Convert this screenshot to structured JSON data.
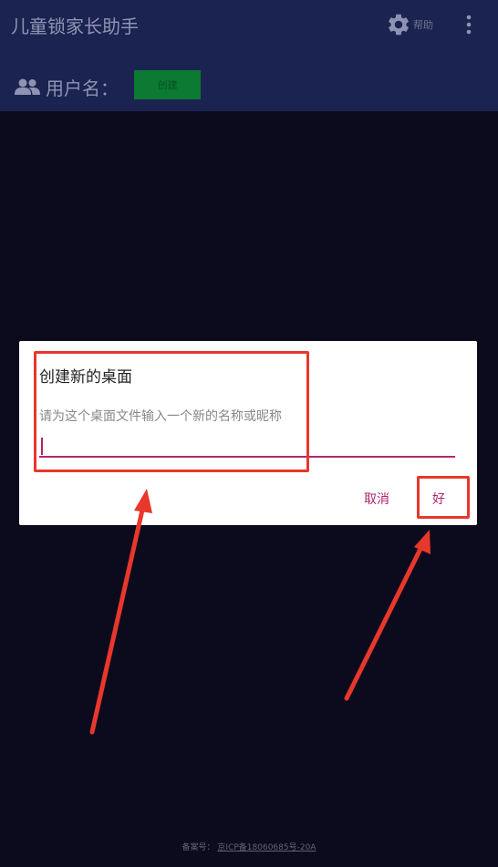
{
  "appbar": {
    "title": "儿童锁家长助手",
    "settings_icon": "gear-icon",
    "settings_label": "帮助",
    "more_icon": "more-vert-icon",
    "user_icon": "users-icon",
    "user_label": "用户名：",
    "create_button": "创建"
  },
  "dialog": {
    "title": "创建新的桌面",
    "message": "请为这个桌面文件输入一个新的名称或昵称",
    "input_value": "",
    "cancel": "取消",
    "ok": "好"
  },
  "footer": {
    "prefix": "备案号：",
    "icp": "京ICP备18060685号-20A"
  },
  "colors": {
    "appbar": "#1b2450",
    "background": "#0c0b1e",
    "accent": "#b0246e",
    "annotation": "#e8372b",
    "create_button": "#0c7a33"
  }
}
